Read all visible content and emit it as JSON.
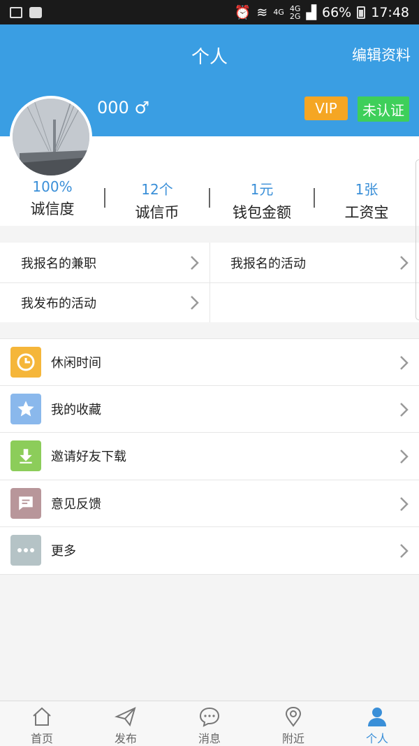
{
  "status_bar": {
    "time": "17:48",
    "battery": "66%",
    "net1": "4G",
    "net2": "4G",
    "net3": "2G"
  },
  "header": {
    "title": "个人",
    "edit_label": "编辑资料"
  },
  "profile": {
    "name": "000 ♂",
    "vip_label": "VIP",
    "cert_label": "未认证"
  },
  "stats": [
    {
      "value": "100%",
      "label": "诚信度"
    },
    {
      "value": "12个",
      "label": "诚信币"
    },
    {
      "value": "1元",
      "label": "钱包金额"
    },
    {
      "value": "1张",
      "label": "工资宝"
    }
  ],
  "grid_links": [
    {
      "label": "我报名的兼职"
    },
    {
      "label": "我报名的活动"
    },
    {
      "label": "我发布的活动"
    }
  ],
  "menu": [
    {
      "label": "休闲时间",
      "icon": "clock-icon",
      "color": "#f5b63a"
    },
    {
      "label": "我的收藏",
      "icon": "star-icon",
      "color": "#8ab8ec"
    },
    {
      "label": "邀请好友下载",
      "icon": "download-icon",
      "color": "#8ccd5a"
    },
    {
      "label": "意见反馈",
      "icon": "feedback-icon",
      "color": "#b8969a"
    },
    {
      "label": "更多",
      "icon": "more-icon",
      "color": "#b5c3c6"
    }
  ],
  "bottom_nav": [
    {
      "label": "首页",
      "icon": "home-icon"
    },
    {
      "label": "发布",
      "icon": "send-icon"
    },
    {
      "label": "消息",
      "icon": "message-icon"
    },
    {
      "label": "附近",
      "icon": "location-icon"
    },
    {
      "label": "个人",
      "icon": "person-icon",
      "active": true
    }
  ],
  "colors": {
    "accent": "#3a9ee3",
    "vip": "#f5a623",
    "cert": "#3ecf5a"
  }
}
